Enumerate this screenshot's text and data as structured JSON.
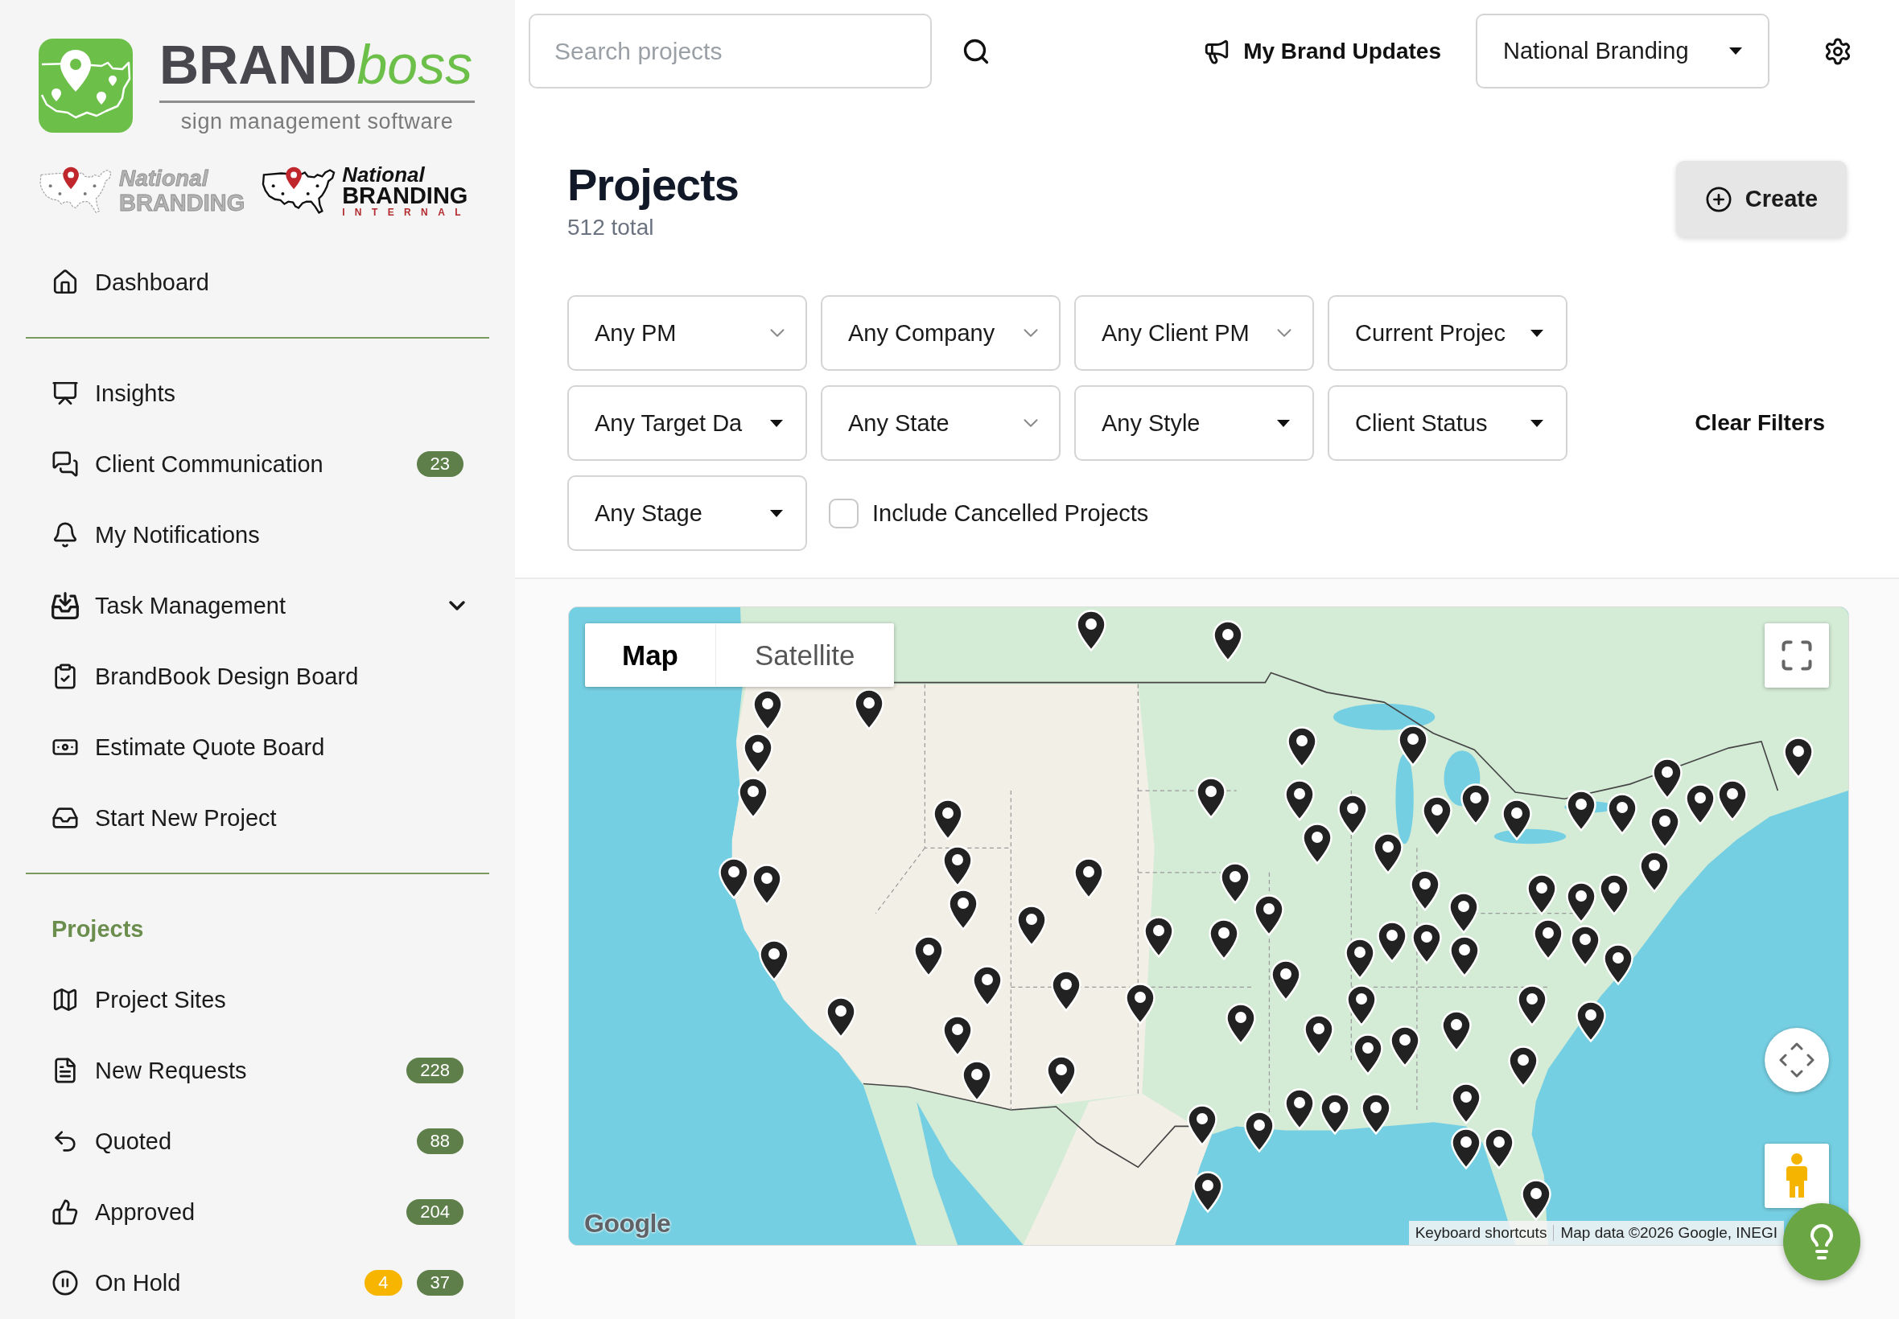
{
  "brand": {
    "wordmark": "**BRAND**boss",
    "tagline": "sign management software",
    "partner_logos": [
      {
        "kind": "outline",
        "line_1": "National",
        "line_2": "BRANDING"
      },
      {
        "kind": "solid",
        "line_1": "National",
        "line_2": "BRANDING",
        "line_3": "INTERNAL"
      }
    ]
  },
  "sidebar": {
    "groups": [
      {
        "items": [
          {
            "label": "Dashboard"
          }
        ]
      },
      {
        "items": [
          {
            "label": "Insights"
          },
          {
            "label": "Client Communication",
            "badges": [
              {
                "text": "23",
                "color": "#5e7f4a"
              }
            ]
          },
          {
            "label": "My Notifications"
          },
          {
            "label": "Task Management",
            "expanded": false
          },
          {
            "label": "BrandBook Design Board"
          },
          {
            "label": "Estimate Quote Board"
          },
          {
            "label": "Start New Project"
          }
        ]
      },
      {
        "heading": "Projects",
        "items": [
          {
            "label": "Project Sites"
          },
          {
            "label": "New Requests",
            "badges": [
              {
                "text": "228",
                "color": "#5e7f4a"
              }
            ]
          },
          {
            "label": "Quoted",
            "badges": [
              {
                "text": "88",
                "color": "#5e7f4a"
              }
            ]
          },
          {
            "label": "Approved",
            "badges": [
              {
                "text": "204",
                "color": "#5e7f4a"
              }
            ]
          },
          {
            "label": "On Hold",
            "badges": [
              {
                "text": "4",
                "color": "#f7b500"
              },
              {
                "text": "37",
                "color": "#5e7f4a"
              }
            ]
          }
        ]
      }
    ]
  },
  "top_bar": {
    "search": {
      "placeholder": "Search projects"
    },
    "updates_link": "My Brand Updates",
    "brand_select": {
      "value": "National Branding"
    }
  },
  "header": {
    "title": "Projects",
    "subtitle": "512 total",
    "create_button": "Create"
  },
  "filters": {
    "dropdowns": [
      {
        "label": "Any PM",
        "kind": "chevron"
      },
      {
        "label": "Any Company",
        "kind": "chevron"
      },
      {
        "label": "Any Client PM",
        "kind": "chevron"
      },
      {
        "label": "Current Projec",
        "kind": "caret"
      },
      {
        "label": "Any Target Da",
        "kind": "caret"
      },
      {
        "label": "Any State",
        "kind": "chevron"
      },
      {
        "label": "Any Style",
        "kind": "caret"
      },
      {
        "label": "Client Status",
        "kind": "caret"
      },
      {
        "label": "Any Stage",
        "kind": "caret"
      }
    ],
    "include_cancelled": {
      "label": "Include Cancelled Projects",
      "checked": false
    },
    "clear_button": "Clear Filters"
  },
  "map": {
    "type_tabs": [
      {
        "label": "Map",
        "selected": true
      },
      {
        "label": "Satellite",
        "selected": false
      }
    ],
    "logo": "Google",
    "shortcuts_link": "Keyboard shortcuts",
    "map_data": "Map data ©2026 Google, INEGI"
  }
}
